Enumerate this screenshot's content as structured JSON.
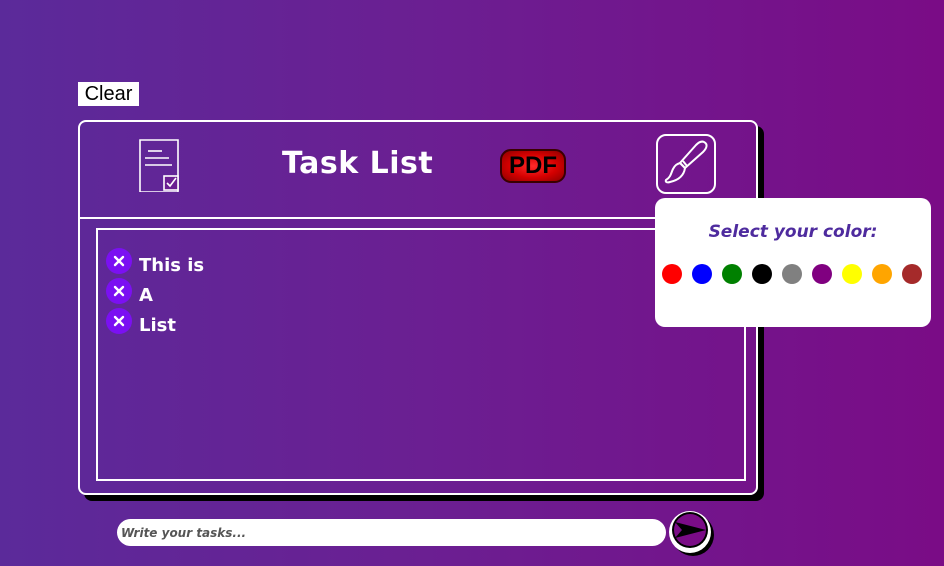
{
  "toolbar": {
    "clear_label": "Clear"
  },
  "card": {
    "title": "Task List",
    "pdf_label": "PDF",
    "icons": {
      "document": "document-check-icon",
      "brush": "paintbrush-icon"
    }
  },
  "tasks": [
    {
      "text": "This is"
    },
    {
      "text": "A"
    },
    {
      "text": "List"
    }
  ],
  "color_picker": {
    "title": "Select your color:",
    "colors": [
      "#ff0000",
      "#0000ff",
      "#008000",
      "#000000",
      "#808080",
      "#800080",
      "#ffff00",
      "#ffa500",
      "#a52a2a"
    ]
  },
  "input": {
    "placeholder": "Write your tasks...",
    "value": ""
  },
  "send": {
    "icon": "send-arrow-icon"
  },
  "theme": {
    "background_start": "#5b2a9a",
    "background_end": "#7a0c86",
    "delete_button": "#7b10f2"
  }
}
